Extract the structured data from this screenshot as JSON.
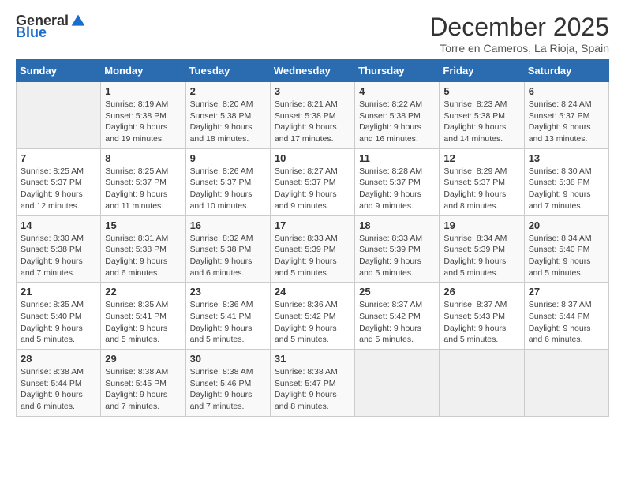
{
  "logo": {
    "general": "General",
    "blue": "Blue"
  },
  "title": "December 2025",
  "location": "Torre en Cameros, La Rioja, Spain",
  "days_of_week": [
    "Sunday",
    "Monday",
    "Tuesday",
    "Wednesday",
    "Thursday",
    "Friday",
    "Saturday"
  ],
  "weeks": [
    [
      {
        "day": "",
        "detail": ""
      },
      {
        "day": "1",
        "detail": "Sunrise: 8:19 AM\nSunset: 5:38 PM\nDaylight: 9 hours and 19 minutes."
      },
      {
        "day": "2",
        "detail": "Sunrise: 8:20 AM\nSunset: 5:38 PM\nDaylight: 9 hours and 18 minutes."
      },
      {
        "day": "3",
        "detail": "Sunrise: 8:21 AM\nSunset: 5:38 PM\nDaylight: 9 hours and 17 minutes."
      },
      {
        "day": "4",
        "detail": "Sunrise: 8:22 AM\nSunset: 5:38 PM\nDaylight: 9 hours and 16 minutes."
      },
      {
        "day": "5",
        "detail": "Sunrise: 8:23 AM\nSunset: 5:38 PM\nDaylight: 9 hours and 14 minutes."
      },
      {
        "day": "6",
        "detail": "Sunrise: 8:24 AM\nSunset: 5:37 PM\nDaylight: 9 hours and 13 minutes."
      }
    ],
    [
      {
        "day": "7",
        "detail": "Sunrise: 8:25 AM\nSunset: 5:37 PM\nDaylight: 9 hours and 12 minutes."
      },
      {
        "day": "8",
        "detail": "Sunrise: 8:25 AM\nSunset: 5:37 PM\nDaylight: 9 hours and 11 minutes."
      },
      {
        "day": "9",
        "detail": "Sunrise: 8:26 AM\nSunset: 5:37 PM\nDaylight: 9 hours and 10 minutes."
      },
      {
        "day": "10",
        "detail": "Sunrise: 8:27 AM\nSunset: 5:37 PM\nDaylight: 9 hours and 9 minutes."
      },
      {
        "day": "11",
        "detail": "Sunrise: 8:28 AM\nSunset: 5:37 PM\nDaylight: 9 hours and 9 minutes."
      },
      {
        "day": "12",
        "detail": "Sunrise: 8:29 AM\nSunset: 5:37 PM\nDaylight: 9 hours and 8 minutes."
      },
      {
        "day": "13",
        "detail": "Sunrise: 8:30 AM\nSunset: 5:38 PM\nDaylight: 9 hours and 7 minutes."
      }
    ],
    [
      {
        "day": "14",
        "detail": "Sunrise: 8:30 AM\nSunset: 5:38 PM\nDaylight: 9 hours and 7 minutes."
      },
      {
        "day": "15",
        "detail": "Sunrise: 8:31 AM\nSunset: 5:38 PM\nDaylight: 9 hours and 6 minutes."
      },
      {
        "day": "16",
        "detail": "Sunrise: 8:32 AM\nSunset: 5:38 PM\nDaylight: 9 hours and 6 minutes."
      },
      {
        "day": "17",
        "detail": "Sunrise: 8:33 AM\nSunset: 5:39 PM\nDaylight: 9 hours and 5 minutes."
      },
      {
        "day": "18",
        "detail": "Sunrise: 8:33 AM\nSunset: 5:39 PM\nDaylight: 9 hours and 5 minutes."
      },
      {
        "day": "19",
        "detail": "Sunrise: 8:34 AM\nSunset: 5:39 PM\nDaylight: 9 hours and 5 minutes."
      },
      {
        "day": "20",
        "detail": "Sunrise: 8:34 AM\nSunset: 5:40 PM\nDaylight: 9 hours and 5 minutes."
      }
    ],
    [
      {
        "day": "21",
        "detail": "Sunrise: 8:35 AM\nSunset: 5:40 PM\nDaylight: 9 hours and 5 minutes."
      },
      {
        "day": "22",
        "detail": "Sunrise: 8:35 AM\nSunset: 5:41 PM\nDaylight: 9 hours and 5 minutes."
      },
      {
        "day": "23",
        "detail": "Sunrise: 8:36 AM\nSunset: 5:41 PM\nDaylight: 9 hours and 5 minutes."
      },
      {
        "day": "24",
        "detail": "Sunrise: 8:36 AM\nSunset: 5:42 PM\nDaylight: 9 hours and 5 minutes."
      },
      {
        "day": "25",
        "detail": "Sunrise: 8:37 AM\nSunset: 5:42 PM\nDaylight: 9 hours and 5 minutes."
      },
      {
        "day": "26",
        "detail": "Sunrise: 8:37 AM\nSunset: 5:43 PM\nDaylight: 9 hours and 5 minutes."
      },
      {
        "day": "27",
        "detail": "Sunrise: 8:37 AM\nSunset: 5:44 PM\nDaylight: 9 hours and 6 minutes."
      }
    ],
    [
      {
        "day": "28",
        "detail": "Sunrise: 8:38 AM\nSunset: 5:44 PM\nDaylight: 9 hours and 6 minutes."
      },
      {
        "day": "29",
        "detail": "Sunrise: 8:38 AM\nSunset: 5:45 PM\nDaylight: 9 hours and 7 minutes."
      },
      {
        "day": "30",
        "detail": "Sunrise: 8:38 AM\nSunset: 5:46 PM\nDaylight: 9 hours and 7 minutes."
      },
      {
        "day": "31",
        "detail": "Sunrise: 8:38 AM\nSunset: 5:47 PM\nDaylight: 9 hours and 8 minutes."
      },
      {
        "day": "",
        "detail": ""
      },
      {
        "day": "",
        "detail": ""
      },
      {
        "day": "",
        "detail": ""
      }
    ]
  ]
}
